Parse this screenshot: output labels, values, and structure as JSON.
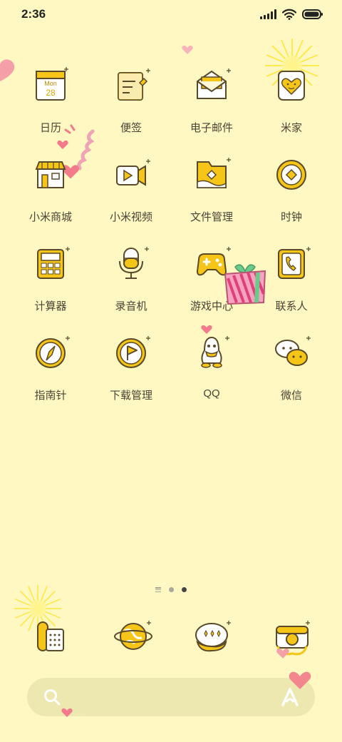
{
  "status_bar": {
    "time": "2:36"
  },
  "apps": [
    {
      "label": "日历",
      "icon": "calendar-icon",
      "month": "Mon",
      "day": "28"
    },
    {
      "label": "便签",
      "icon": "notes-icon"
    },
    {
      "label": "电子邮件",
      "icon": "email-icon"
    },
    {
      "label": "米家",
      "icon": "mijia-icon"
    },
    {
      "label": "小米商城",
      "icon": "store-icon"
    },
    {
      "label": "小米视频",
      "icon": "video-icon"
    },
    {
      "label": "文件管理",
      "icon": "file-manager-icon"
    },
    {
      "label": "时钟",
      "icon": "clock-icon"
    },
    {
      "label": "计算器",
      "icon": "calculator-icon"
    },
    {
      "label": "录音机",
      "icon": "recorder-icon"
    },
    {
      "label": "游戏中心",
      "icon": "game-center-icon"
    },
    {
      "label": "联系人",
      "icon": "contacts-icon"
    },
    {
      "label": "指南针",
      "icon": "compass-icon"
    },
    {
      "label": "下载管理",
      "icon": "download-icon"
    },
    {
      "label": "QQ",
      "icon": "qq-icon"
    },
    {
      "label": "微信",
      "icon": "wechat-icon"
    }
  ],
  "page_indicator": {
    "pages": 3,
    "current": 3
  },
  "dock": [
    {
      "icon": "phone-icon"
    },
    {
      "icon": "browser-icon"
    },
    {
      "icon": "messages-icon"
    },
    {
      "icon": "camera-icon"
    }
  ],
  "colors": {
    "background": "#FFF8C2",
    "accent": "#F5C518",
    "stroke": "#5A4A2A",
    "heart": "#F27A8A"
  }
}
